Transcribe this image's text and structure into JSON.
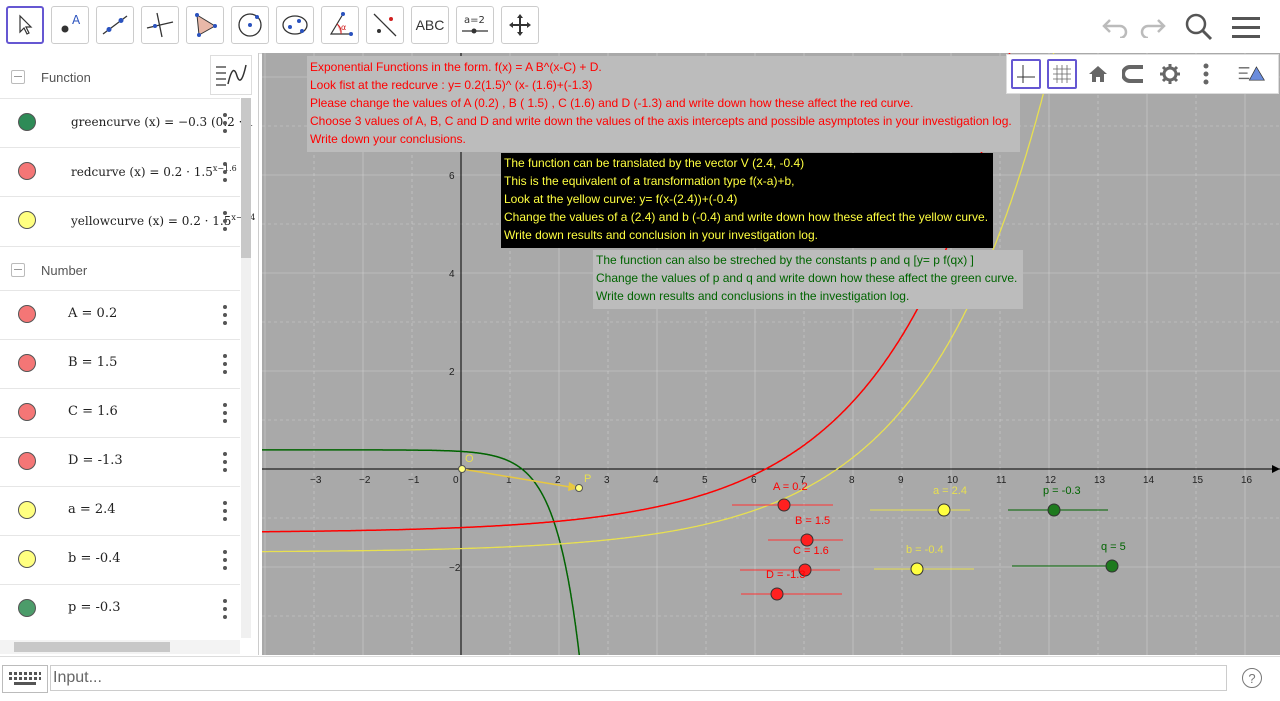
{
  "toolbar": {
    "text_tool_label": "ABC",
    "slider_tool_label": "a=2"
  },
  "algebra": {
    "function_header": "Function",
    "number_header": "Number",
    "functions": [
      {
        "label": "greencurve (x)  =  −0.3  (0.2 · 1",
        "color": "#2e8b57"
      },
      {
        "label": "redcurve (x)  =  0.2 · 1.5^(x−1.6)",
        "color": "#ff3333"
      },
      {
        "label": "yellowcurve (x)  =  0.2 · 1.5^(x−2.4)",
        "color": "#ffff66"
      }
    ],
    "numbers": [
      {
        "label": "A = 0.2",
        "color": "#ff3333"
      },
      {
        "label": "B = 1.5",
        "color": "#ff3333"
      },
      {
        "label": "C = 1.6",
        "color": "#ff3333"
      },
      {
        "label": "D = -1.3",
        "color": "#ff3333"
      },
      {
        "label": "a = 2.4",
        "color": "#ffff66"
      },
      {
        "label": "b = -0.4",
        "color": "#ffff66"
      },
      {
        "label": "p = -0.3",
        "color": "#2e8b57"
      }
    ]
  },
  "graphics": {
    "x_ticks": [
      "−3",
      "−2",
      "−1",
      "0",
      "1",
      "2",
      "3",
      "4",
      "5",
      "6",
      "7",
      "8",
      "9",
      "10",
      "11",
      "12",
      "13",
      "14",
      "15",
      "16"
    ],
    "y_ticks": [
      "6",
      "4",
      "2",
      "−2"
    ],
    "point_labels": {
      "O": "O",
      "P": "P"
    },
    "box1": {
      "lines": [
        "Exponential Functions in the form. f(x) = A B^(x-C) +  D.",
        "Look fist at the redcurve : y= 0.2(1.5)^ (x- (1.6)+(-1.3)",
        "Please change the values of A (0.2) , B ( 1.5) , C (1.6) and D (-1.3) and write down how these affect the red curve.",
        "Choose 3 values of A, B, C and D and write down the values of the axis intercepts and possible asymptotes in your investigation log.",
        "Write down your conclusions."
      ]
    },
    "box2": {
      "lines": [
        "The function can be translated by the vector V (2.4, -0.4)",
        "This is the equivalent of a transformation type f(x-a)+b,",
        "Look at the yellow curve: y= f(x-(2.4))+(-0.4)",
        "Change the values of a (2.4) and b (-0.4) and write down how these affect the yellow curve.",
        "Write down results and conclusion in your investigation log."
      ]
    },
    "box3": {
      "lines": [
        "The function can also be streched by the constants p and q [y= p f(qx) ]",
        "Change the values of p and q and write down how these affect the green curve.",
        "Write down results and conclusions in the investigation log."
      ]
    },
    "sliders": {
      "A": "A = 0.2",
      "B": "B = 1.5",
      "C": "C = 1.6",
      "D": "D = -1.3",
      "a": "a = 2.4",
      "b": "b = -0.4",
      "p": "p = -0.3",
      "q": "q = 5"
    }
  },
  "input": {
    "placeholder": "Input..."
  },
  "colors": {
    "red": "#ff0000",
    "yellow": "#e8e050",
    "green": "#006400",
    "accent": "#6557d2"
  }
}
